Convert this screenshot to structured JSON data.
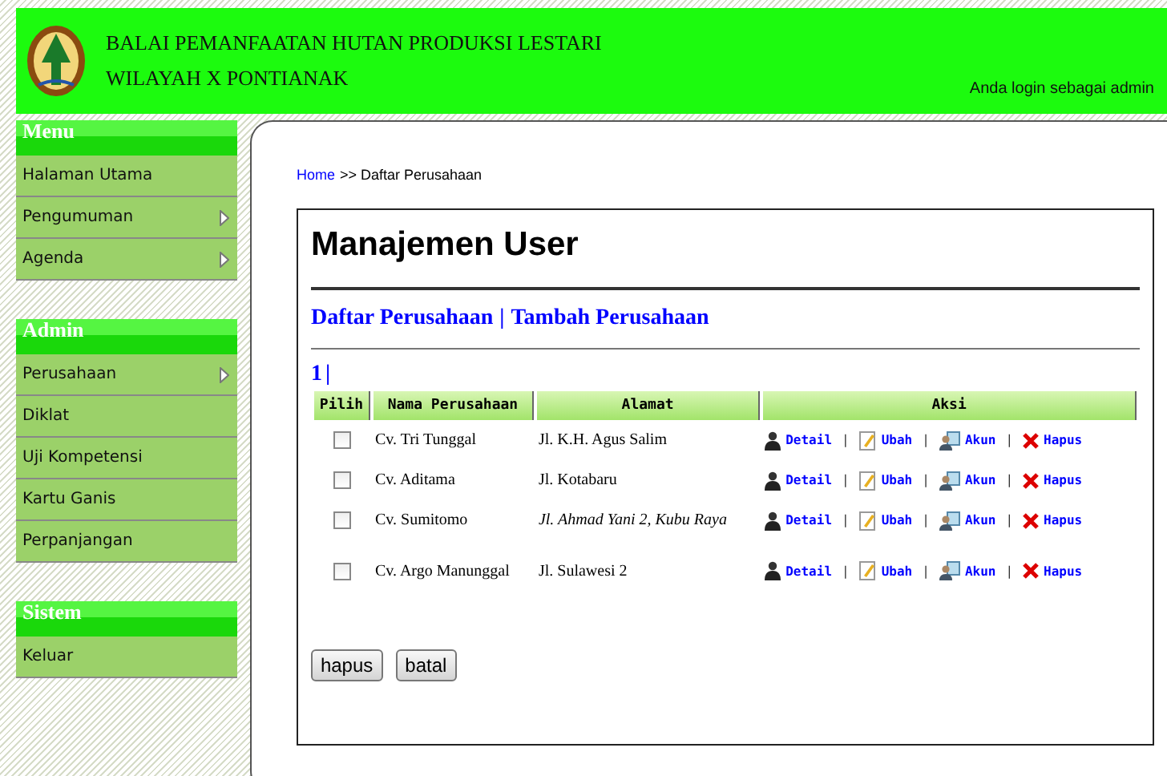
{
  "header": {
    "title_lines": [
      "BALAI PEMANFAATAN HUTAN PRODUKSI LESTARI",
      "WILAYAH X PONTIANAK"
    ],
    "login_text": "Anda login sebagai admin"
  },
  "sidebar": [
    {
      "heading": "Menu",
      "items": [
        {
          "label": "Halaman Utama",
          "has_submenu": false
        },
        {
          "label": "Pengumuman",
          "has_submenu": true
        },
        {
          "label": "Agenda",
          "has_submenu": true
        }
      ]
    },
    {
      "heading": "Admin",
      "items": [
        {
          "label": "Perusahaan",
          "has_submenu": true
        },
        {
          "label": "Diklat",
          "has_submenu": false
        },
        {
          "label": "Uji Kompetensi",
          "has_submenu": false
        },
        {
          "label": "Kartu Ganis",
          "has_submenu": false
        },
        {
          "label": "Perpanjangan",
          "has_submenu": false
        }
      ]
    },
    {
      "heading": "Sistem",
      "items": [
        {
          "label": "Keluar",
          "has_submenu": false
        }
      ]
    }
  ],
  "breadcrumb": {
    "link": "Home",
    "rest": ">> Daftar Perusahaan"
  },
  "page_title": "Manajemen User",
  "subnav": {
    "links": [
      "Daftar Perusahaan",
      "Tambah Perusahaan"
    ],
    "separator": "|"
  },
  "pagination": {
    "page": "1",
    "separator": "|"
  },
  "table": {
    "columns": [
      "Pilih",
      "Nama Perusahaan",
      "Alamat",
      "Aksi"
    ],
    "action_separator": "|",
    "rows": [
      {
        "checked": false,
        "name": "Cv. Tri Tunggal",
        "address": "Jl. K.H. Agus Salim",
        "italic": false,
        "actions": [
          "Detail",
          "Ubah",
          "Akun",
          "Hapus"
        ]
      },
      {
        "checked": false,
        "name": "Cv. Aditama",
        "address": "Jl. Kotabaru",
        "italic": false,
        "actions": [
          "Detail",
          "Ubah",
          "Akun",
          "Hapus"
        ]
      },
      {
        "checked": false,
        "name": "Cv. Sumitomo",
        "address": "Jl. Ahmad Yani 2, Kubu Raya",
        "italic": true,
        "actions": [
          "Detail",
          "Ubah",
          "Akun",
          "Hapus"
        ]
      },
      {
        "checked": false,
        "name": "Cv. Argo Manunggal",
        "address": "Jl. Sulawesi 2",
        "italic": false,
        "actions": [
          "Detail",
          "Ubah",
          "Akun",
          "Hapus"
        ]
      }
    ]
  },
  "buttons": [
    "hapus",
    "batal"
  ]
}
